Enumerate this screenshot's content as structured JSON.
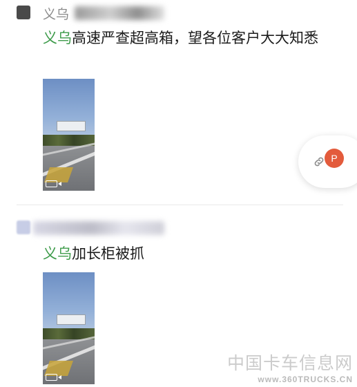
{
  "posts": [
    {
      "author_prefix": "义乌",
      "text_highlight": "义乌",
      "text_rest": "高速严查超高箱，望各位客户大大知悉"
    },
    {
      "author_prefix": "",
      "text_highlight": "义乌",
      "text_rest": "加长柜被抓"
    }
  ],
  "float_panel": {
    "avatar_letter": "P",
    "link_icon": "link-icon"
  },
  "watermark": {
    "main": "中国卡车信息网",
    "sub": "www.360TRUCKS.CN"
  },
  "colors": {
    "highlight": "#3d9b4a",
    "avatar_p": "#e35b3c"
  }
}
